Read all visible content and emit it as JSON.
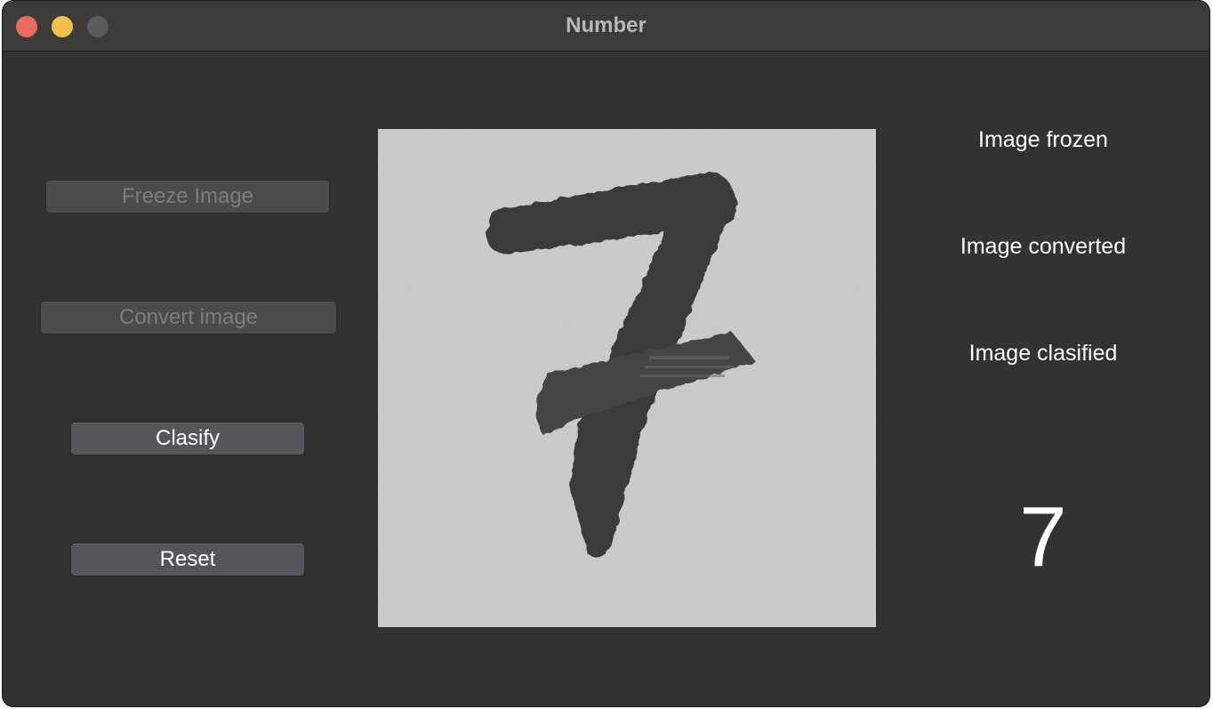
{
  "window": {
    "title": "Number"
  },
  "buttons": {
    "freeze": {
      "label": "Freeze Image",
      "enabled": false
    },
    "convert": {
      "label": "Convert image",
      "enabled": false
    },
    "clasify": {
      "label": "Clasify",
      "enabled": true
    },
    "reset": {
      "label": "Reset",
      "enabled": true
    }
  },
  "image": {
    "content": "handwritten-digit-photo",
    "digit_depicted": "7"
  },
  "status": {
    "frozen": "Image frozen",
    "converted": "Image converted",
    "clasified": "Image clasified"
  },
  "result": {
    "prediction": "7"
  },
  "colors": {
    "window_bg": "#323232",
    "titlebar_bg": "#3c3b3a",
    "close": "#ed6a5e",
    "minimize": "#f5bf4f",
    "maximize_inactive": "#5b5a59",
    "button_bg": "#56555b",
    "button_disabled_text": "#7d7d7d",
    "ink": "#3a3a3a",
    "paper": "#c9c9c9"
  }
}
